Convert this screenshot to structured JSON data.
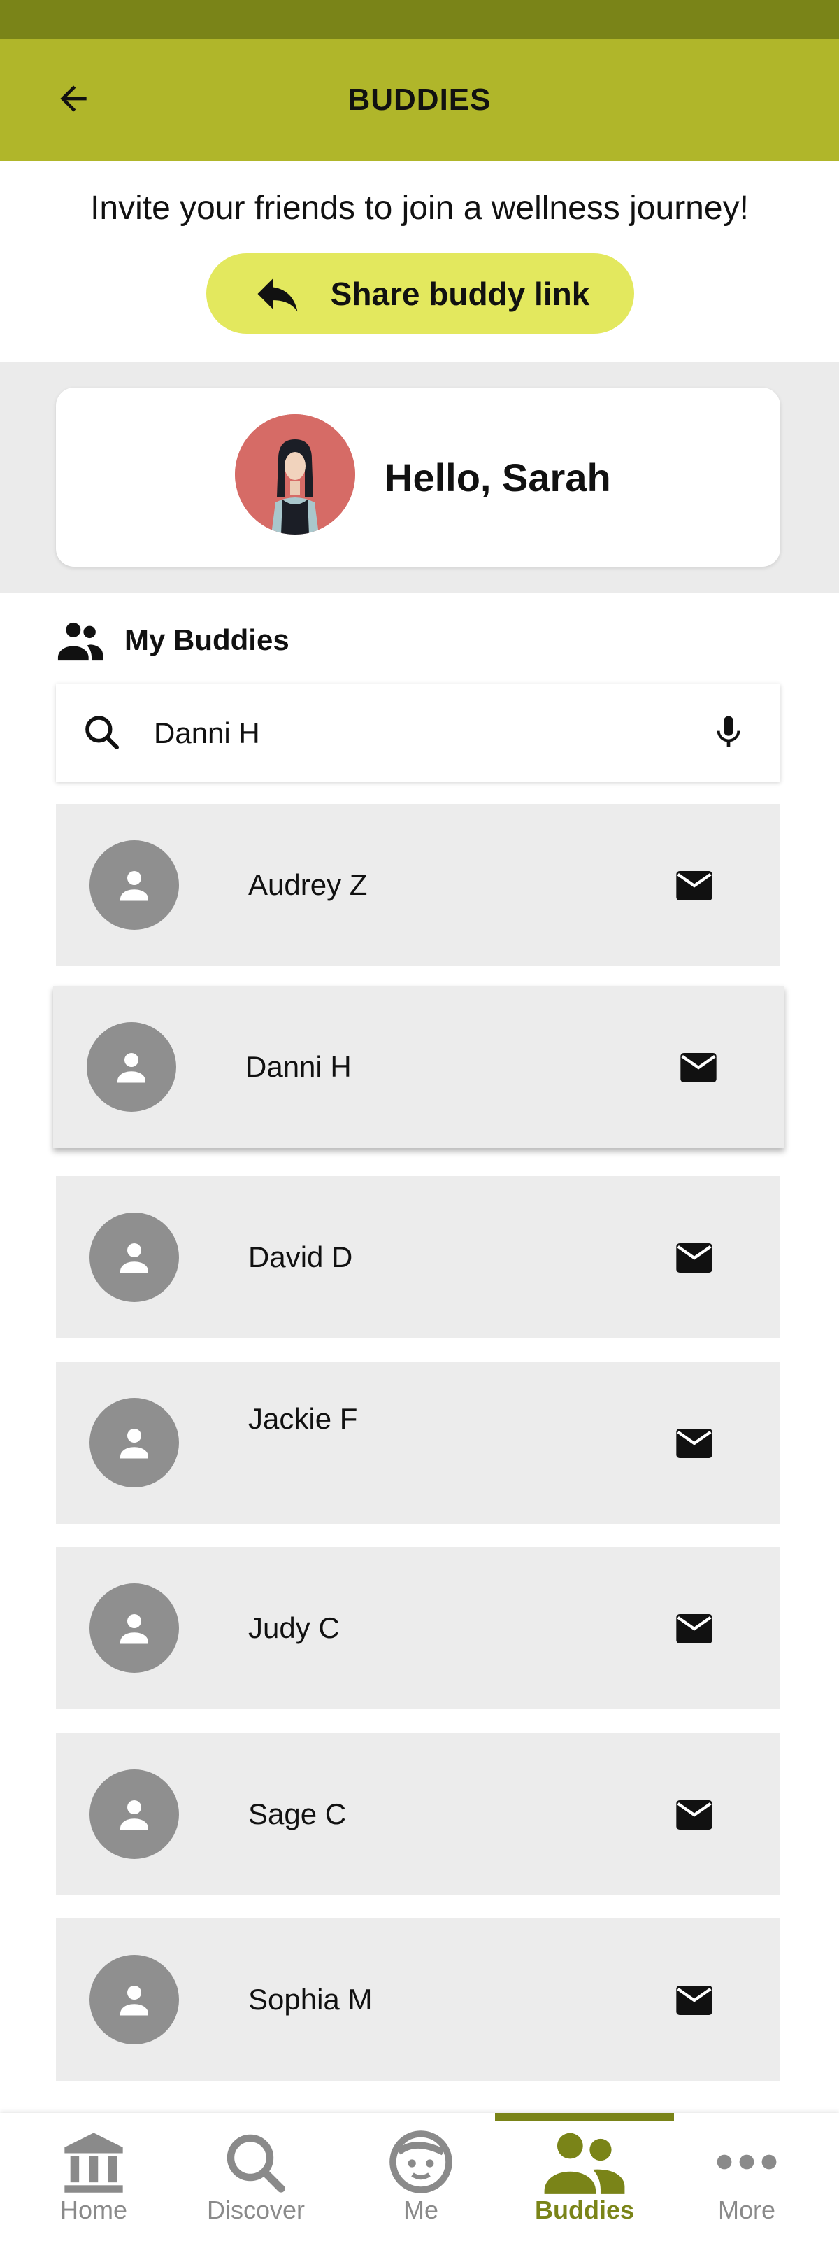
{
  "app_bar": {
    "title": "BUDDIES"
  },
  "invite": {
    "text": "Invite your friends to join a wellness journey!",
    "share_label": "Share buddy link"
  },
  "profile": {
    "greeting": "Hello, Sarah"
  },
  "buddies_section": {
    "title": "My Buddies"
  },
  "search": {
    "value": "Danni H"
  },
  "buddies": [
    {
      "name": "Audrey Z"
    },
    {
      "name": "Danni H"
    },
    {
      "name": "David D"
    },
    {
      "name": "Jackie F"
    },
    {
      "name": "Judy C"
    },
    {
      "name": "Sage C"
    },
    {
      "name": "Sophia M"
    }
  ],
  "nav": [
    {
      "label": "Home",
      "icon": "bank-icon"
    },
    {
      "label": "Discover",
      "icon": "search-icon"
    },
    {
      "label": "Me",
      "icon": "face-icon"
    },
    {
      "label": "Buddies",
      "icon": "people-icon",
      "active": true
    },
    {
      "label": "More",
      "icon": "more-dots-icon"
    }
  ],
  "colors": {
    "status_bar": "#7a8418",
    "app_bar": "#b0b62a",
    "share_button": "#e3e85e",
    "nav_active": "#7a8418",
    "nav_inactive": "#8a8a8a",
    "card_bg": "#ececec"
  }
}
